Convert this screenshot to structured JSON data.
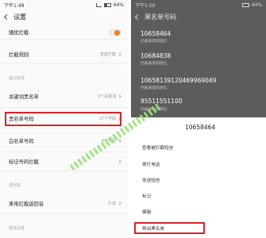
{
  "left": {
    "status": {
      "time": "下午1:49",
      "battery": "44%"
    },
    "title": "设置",
    "rows": {
      "harass": {
        "label": "骚扰拦截"
      },
      "rules": {
        "label": "拦截规则",
        "value": "智能拦截"
      },
      "keyword": {
        "label": "关键词黑名单",
        "value": "0个关键词"
      },
      "blacklist": {
        "label": "黑名单号码",
        "value": "17个号码"
      },
      "whitelist": {
        "label": "白名单号码",
        "value": "0个号码"
      },
      "marked": {
        "label": "标记号码拦截"
      },
      "ringback": {
        "label": "来电拦截返回音",
        "value": "忙音"
      }
    },
    "sections": {
      "bw": "黑白名单",
      "ret": "返回音",
      "other": "其他设置"
    }
  },
  "right": {
    "status": {
      "time": "下午1:50",
      "battery": "44%"
    },
    "title": "黑名单号码",
    "numbers": [
      {
        "number": "10658464",
        "sub": "拦截来电和短信"
      },
      {
        "number": "10684838",
        "sub": "拦截来电和短信"
      },
      {
        "number": "10658139120469969049",
        "sub": "拦截来电和短信"
      },
      {
        "number": "95511551100",
        "sub": "拦截来电和短信"
      }
    ],
    "sheet": {
      "title": "10658464",
      "items": [
        "查看被拦截短信",
        "拨打电话",
        "发送短信",
        "标记",
        "编辑",
        "移出黑名单"
      ]
    }
  },
  "colors": {
    "accent": "#f57c1f",
    "highlight": "#d8232a",
    "arrow": "#9be27a"
  }
}
